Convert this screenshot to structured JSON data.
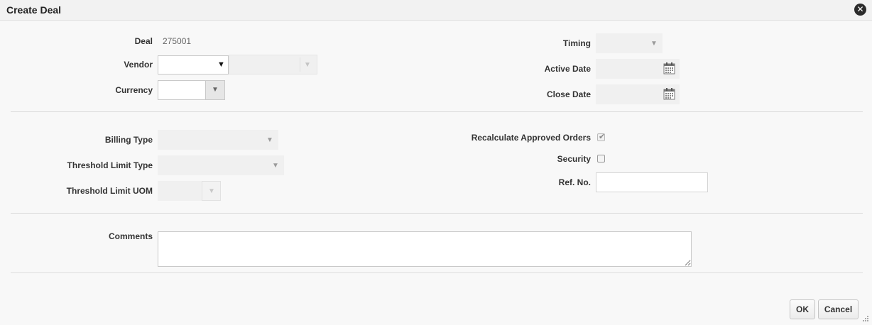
{
  "dialog": {
    "title": "Create Deal",
    "close_icon": "close-icon"
  },
  "header_section": {
    "deal_label": "Deal",
    "deal_value": "275001",
    "vendor_label": "Vendor",
    "vendor_value": "",
    "vendor_site_value": "",
    "currency_label": "Currency",
    "currency_value": "",
    "timing_label": "Timing",
    "timing_value": "",
    "active_date_label": "Active Date",
    "active_date_value": "",
    "close_date_label": "Close Date",
    "close_date_value": ""
  },
  "billing_section": {
    "billing_type_label": "Billing Type",
    "billing_type_value": "",
    "threshold_limit_type_label": "Threshold Limit Type",
    "threshold_limit_type_value": "",
    "threshold_limit_uom_label": "Threshold Limit UOM",
    "threshold_limit_uom_value": "",
    "recalculate_label": "Recalculate Approved Orders",
    "recalculate_checked": true,
    "security_label": "Security",
    "security_checked": false,
    "ref_no_label": "Ref. No.",
    "ref_no_value": ""
  },
  "comments_section": {
    "comments_label": "Comments",
    "comments_value": ""
  },
  "footer": {
    "ok_label": "OK",
    "cancel_label": "Cancel"
  },
  "icons": {
    "dropdown": "chevron-down-icon",
    "calendar": "calendar-icon",
    "checkmark": "checkmark-icon",
    "resize": "resize-grip-icon"
  }
}
